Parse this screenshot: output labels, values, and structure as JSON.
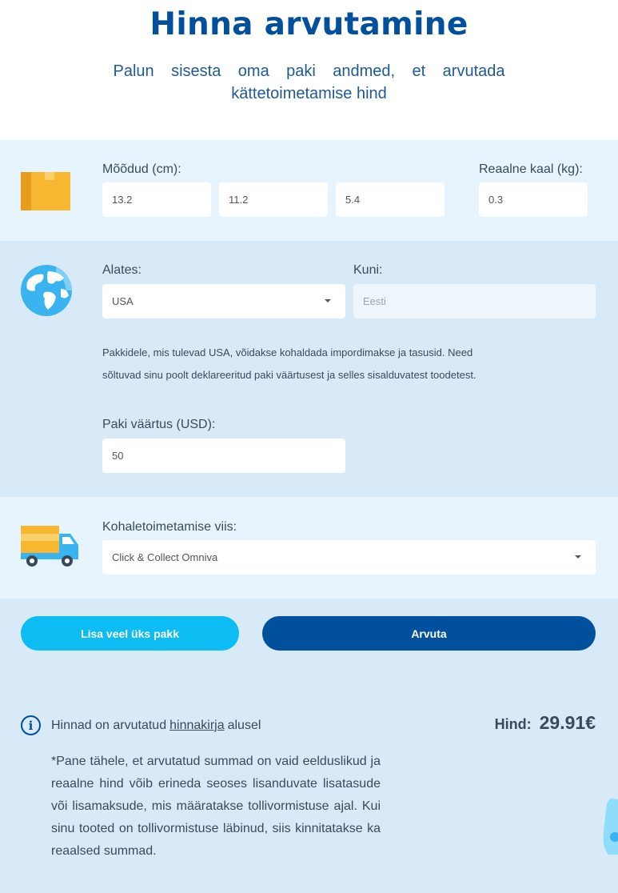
{
  "header": {
    "title": "Hinna arvutamine",
    "subtitle": "Palun sisesta oma paki andmed, et arvutada kättetoimetamise hind"
  },
  "dimensions": {
    "icon": "box-icon",
    "label": "Mõõdud (cm):",
    "length": "13.2",
    "width": "11.2",
    "height": "5.4",
    "weight_label": "Reaalne kaal (kg):",
    "weight": "0.3"
  },
  "route": {
    "icon": "globe-icon",
    "from_label": "Alates:",
    "from_value": "USA",
    "to_label": "Kuni:",
    "to_value": "Eesti",
    "note": "Pakkidele, mis tulevad USA, võidakse kohaldada impordimakse ja tasusid. Need sõltuvad sinu poolt deklareeritud paki väärtusest ja selles sisalduvatest toodetest.",
    "value_label": "Paki väärtus (USD):",
    "value": "50"
  },
  "delivery": {
    "icon": "truck-icon",
    "label": "Kohaletoimetamise viis:",
    "method": "Click & Collect Omniva"
  },
  "actions": {
    "add_package": "Lisa veel üks pakk",
    "calculate": "Arvuta"
  },
  "result": {
    "info_before": "Hinnad on arvutatud",
    "info_link": "hinnakirja",
    "info_after": "alusel",
    "price_label": "Hind:",
    "price_value": "29.91€",
    "disclaimer": "*Pane tähele, et arvutatud summad on vaid eelduslikud ja reaalne hind võib erineda seoses lisanduvate lisatasude või lisamaksude, mis määratakse tollivormistuse ajal. Kui sinu tooted on tollivormistuse läbinud, siis kinnitatakse ka reaalsed summad."
  },
  "colors": {
    "primary": "#00509e",
    "accent": "#0cbcf2",
    "section_light": "#e7f4fd",
    "section_dark": "#d8eaf8"
  }
}
